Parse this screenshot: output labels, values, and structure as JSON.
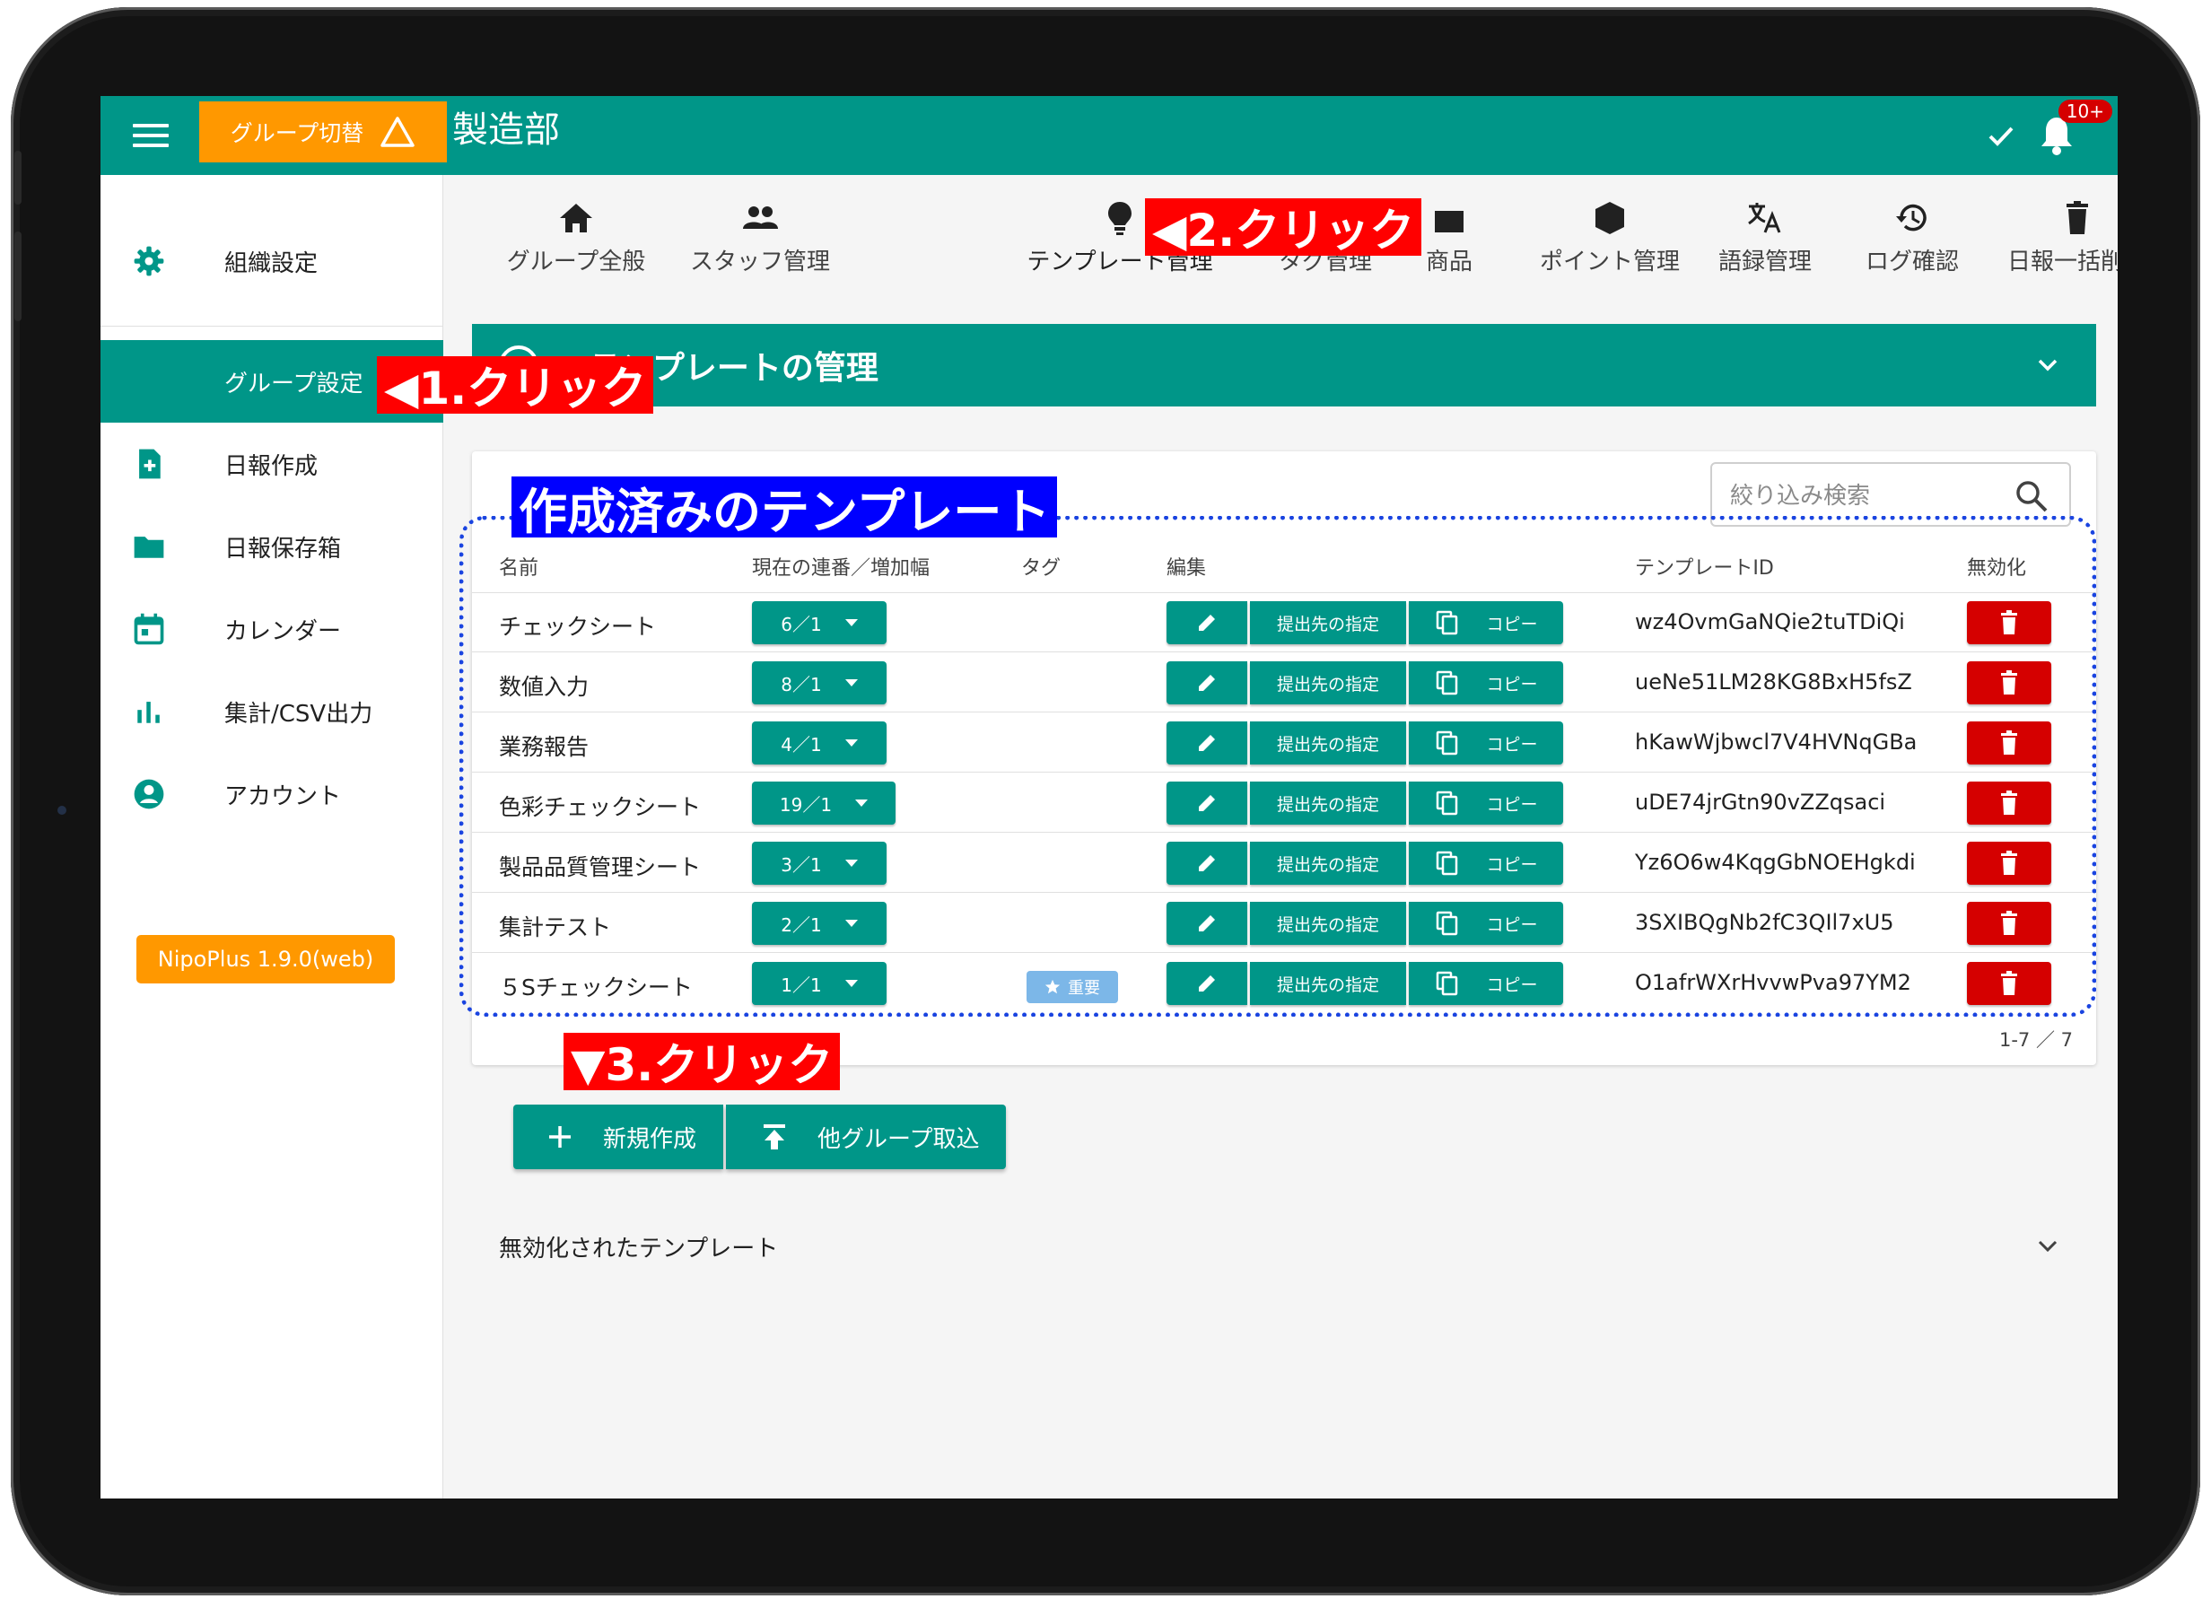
{
  "header": {
    "group_switch_label": "グループ切替",
    "department": "製造部",
    "notification_badge": "10+"
  },
  "sidebar": {
    "items": [
      {
        "label": "組織設定",
        "icon": "gear-icon"
      },
      {
        "label": "グループ設定",
        "icon": "",
        "active": true
      },
      {
        "label": "日報作成",
        "icon": "file-plus-icon"
      },
      {
        "label": "日報保存箱",
        "icon": "folder-icon"
      },
      {
        "label": "カレンダー",
        "icon": "calendar-icon"
      },
      {
        "label": "集計/CSV出力",
        "icon": "bar-chart-icon"
      },
      {
        "label": "アカウント",
        "icon": "account-circle-icon"
      }
    ],
    "version": "NipoPlus 1.9.0(web)"
  },
  "tabs": [
    {
      "label": "グループ全般",
      "icon": "home-icon"
    },
    {
      "label": "スタッフ管理",
      "icon": "people-icon"
    },
    {
      "label": "テンプレート管理",
      "icon": "lightbulb-icon",
      "active": true
    },
    {
      "label": "タグ管理",
      "icon": "tag-icon"
    },
    {
      "label": "商品",
      "icon": "shop-icon"
    },
    {
      "label": "ポイント管理",
      "icon": "cube-icon"
    },
    {
      "label": "語録管理",
      "icon": "translate-icon"
    },
    {
      "label": "ログ確認",
      "icon": "history-icon"
    },
    {
      "label": "日報一括削除",
      "icon": "trash-icon"
    }
  ],
  "section": {
    "title": "テンプレートの管理"
  },
  "card": {
    "search_placeholder": "絞り込み検索",
    "columns": {
      "name": "名前",
      "sequence": "現在の連番／増加幅",
      "tag": "タグ",
      "edit": "編集",
      "template_id": "テンプレートID",
      "disable": "無効化"
    },
    "buttons": {
      "destination": "提出先の指定",
      "copy": "コピー"
    },
    "rows": [
      {
        "name": "チェックシート",
        "sequence": "6／1",
        "tag": "",
        "id": "wz4OvmGaNQie2tuTDiQi"
      },
      {
        "name": "数値入力",
        "sequence": "8／1",
        "tag": "",
        "id": "ueNe51LM28KG8BxH5fsZ"
      },
      {
        "name": "業務報告",
        "sequence": "4／1",
        "tag": "",
        "id": "hKawWjbwcl7V4HVNqGBa"
      },
      {
        "name": "色彩チェックシート",
        "sequence": "19／1",
        "tag": "",
        "id": "uDE74jrGtn90vZZqsaci"
      },
      {
        "name": "製品品質管理シート",
        "sequence": "3／1",
        "tag": "",
        "id": "Yz6O6w4KqgGbNOEHgkdi"
      },
      {
        "name": "集計テスト",
        "sequence": "2／1",
        "tag": "",
        "id": "3SXIBQgNb2fC3QIl7xU5"
      },
      {
        "name": "５Sチェックシート",
        "sequence": "1／1",
        "tag": "重要",
        "id": "O1afrWXrHvvwPva97YM2"
      }
    ],
    "pagination": "1-7 ／ 7"
  },
  "actions": {
    "new_label": "新規作成",
    "import_label": "他グループ取込"
  },
  "disabled_section": {
    "title": "無効化されたテンプレート"
  },
  "annotations": {
    "step1": "◀1.クリック",
    "step2": "◀2.クリック",
    "step3": "▼3.クリック",
    "created_templates": "作成済みのテンプレート"
  },
  "colors": {
    "primary": "#009688",
    "accent_orange": "#ff9800",
    "danger": "#d50000",
    "annotation_red": "#ff0000",
    "annotation_blue": "#0000ff"
  }
}
